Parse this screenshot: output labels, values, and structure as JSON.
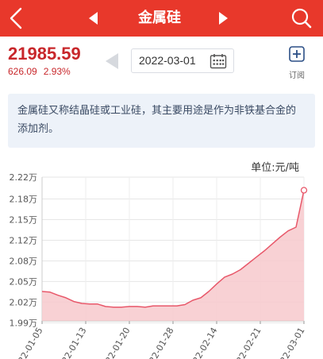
{
  "header": {
    "title": "金属硅",
    "background_color": "#e8382b",
    "icons": [
      "back-icon",
      "prev-arrow-icon",
      "next-arrow-icon",
      "search-icon"
    ]
  },
  "quote": {
    "price": "21985.59",
    "change": "626.09",
    "change_percent": "2.93%",
    "color": "#c8272b"
  },
  "date_picker": {
    "value": "2022-03-01",
    "icons": [
      "prev-arrow-icon",
      "calendar-icon"
    ]
  },
  "subscribe": {
    "label": "订阅",
    "icon": "plus-square-icon"
  },
  "description": "金属硅又称结晶硅或工业硅，其主要用途是作为非铁基合金的添加剂。",
  "unit_label": "单位:元/吨",
  "chart_data": {
    "type": "area",
    "title": "",
    "xlabel": "",
    "ylabel": "",
    "ylim": [
      1.99,
      2.22
    ],
    "y_ticks": [
      "2.22万",
      "2.18万",
      "2.15万",
      "2.12万",
      "2.08万",
      "2.05万",
      "2.02万",
      "1.99万"
    ],
    "y_tick_values": [
      2.22,
      2.185,
      2.152,
      2.119,
      2.086,
      2.053,
      2.02,
      1.987
    ],
    "x_ticks": [
      "2022-01-05",
      "2022-01-13",
      "2022-01-20",
      "2022-01-28",
      "2022-02-14",
      "2022-02-21",
      "2022-03-01"
    ],
    "x_tick_positions": [
      0,
      6,
      12,
      18,
      24,
      30,
      36
    ],
    "x": [
      0,
      1,
      2,
      3,
      4,
      5,
      6,
      7,
      8,
      9,
      10,
      11,
      12,
      13,
      14,
      15,
      16,
      17,
      18,
      19,
      20,
      21,
      22,
      23,
      24,
      25,
      26,
      27,
      28,
      29,
      30,
      31,
      32,
      33,
      34,
      35,
      36
    ],
    "series": [
      {
        "values": [
          2.037,
          2.036,
          2.031,
          2.027,
          2.021,
          2.018,
          2.017,
          2.017,
          2.013,
          2.012,
          2.012,
          2.013,
          2.013,
          2.012,
          2.014,
          2.014,
          2.014,
          2.014,
          2.016,
          2.023,
          2.027,
          2.037,
          2.049,
          2.06,
          2.065,
          2.072,
          2.082,
          2.092,
          2.102,
          2.113,
          2.124,
          2.134,
          2.14,
          2.199
        ],
        "color": "#e8586a",
        "fill": "#f7c9cc"
      }
    ],
    "grid": true,
    "marker_last_point": true,
    "legend": "none"
  }
}
